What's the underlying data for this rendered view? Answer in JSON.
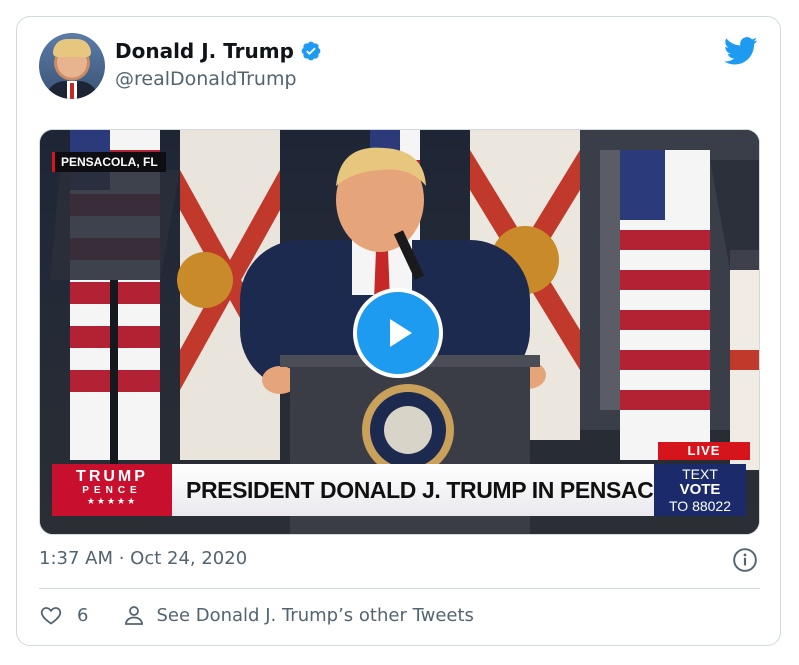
{
  "tweet": {
    "author_name": "Donald J. Trump",
    "handle": "@realDonaldTrump",
    "timestamp": "1:37 AM · Oct 24, 2020",
    "like_count": "6",
    "other_tweets_label": "See Donald J. Trump’s other Tweets"
  },
  "video": {
    "location_tag": "PENSACOLA, FL",
    "live_label": "LIVE",
    "logo_line1": "TRUMP",
    "logo_line2": "PENCE",
    "logo_stars": "★★★★★",
    "headline": "PRESIDENT DONALD J. TRUMP IN PENSACOLA, FL",
    "vote_line1": "TEXT",
    "vote_line2": "VOTE",
    "vote_line3": "TO 88022"
  },
  "icons": {
    "verified": "verified-badge-icon",
    "twitter": "twitter-bird-icon",
    "play": "play-icon",
    "info": "info-icon",
    "like": "heart-icon",
    "profile": "person-icon"
  },
  "colors": {
    "accent": "#1d9bf0",
    "text_primary": "#0f1419",
    "text_secondary": "#536471",
    "border": "#cfd9de",
    "banner_red": "#c8102e",
    "banner_blue": "#1b2a6b"
  }
}
